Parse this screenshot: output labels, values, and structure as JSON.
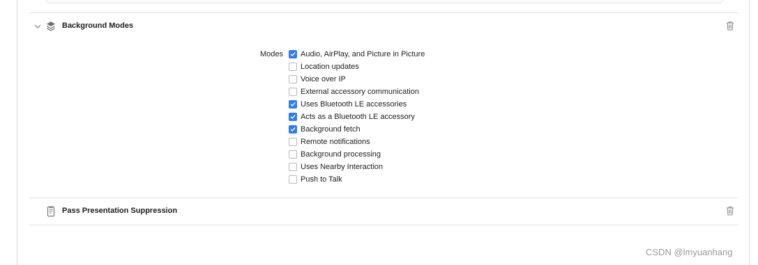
{
  "capabilities": [
    {
      "title": "Background Modes",
      "icon": "layers-icon",
      "expanded": true,
      "modes_label": "Modes",
      "modes": [
        {
          "label": "Audio, AirPlay, and Picture in Picture",
          "checked": true
        },
        {
          "label": "Location updates",
          "checked": false
        },
        {
          "label": "Voice over IP",
          "checked": false
        },
        {
          "label": "External accessory communication",
          "checked": false
        },
        {
          "label": "Uses Bluetooth LE accessories",
          "checked": true
        },
        {
          "label": "Acts as a Bluetooth LE accessory",
          "checked": true
        },
        {
          "label": "Background fetch",
          "checked": true
        },
        {
          "label": "Remote notifications",
          "checked": false
        },
        {
          "label": "Background processing",
          "checked": false
        },
        {
          "label": "Uses Nearby Interaction",
          "checked": false
        },
        {
          "label": "Push to Talk",
          "checked": false
        }
      ]
    },
    {
      "title": "Pass Presentation Suppression",
      "icon": "pass-icon"
    }
  ],
  "colors": {
    "accent": "#2f7cf6",
    "checkbox_border": "#b9b9b9",
    "separator": "#e3e3e3",
    "watermark": "#9a9a9a"
  },
  "watermark": "CSDN @lmyuanhang"
}
